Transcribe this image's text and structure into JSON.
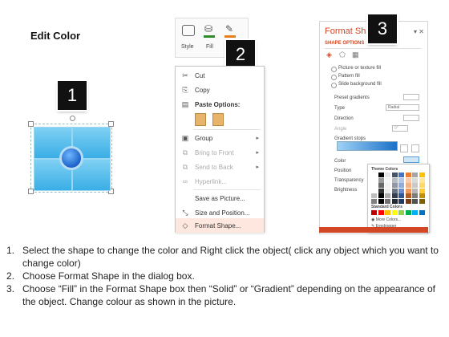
{
  "title": "Edit Color",
  "badges": {
    "one": "1",
    "two": "2",
    "three": "3"
  },
  "ribbon": {
    "style": "Style",
    "fill": "Fill",
    "outline": "O"
  },
  "context_menu": {
    "items": [
      {
        "icon": "scissors-icon",
        "glyph": "✂",
        "label": "Cut",
        "disabled": false
      },
      {
        "icon": "copy-icon",
        "glyph": "⎘",
        "label": "Copy",
        "disabled": false
      },
      {
        "icon": "clipboard-icon",
        "glyph": "📋",
        "label": "Paste Options:",
        "disabled": false
      },
      {
        "icon": "group-icon",
        "glyph": "▣",
        "label": "Group",
        "disabled": false,
        "submenu": true
      },
      {
        "icon": "bring-front-icon",
        "glyph": "⧉",
        "label": "Bring to Front",
        "disabled": true,
        "submenu": true
      },
      {
        "icon": "send-back-icon",
        "glyph": "⧉",
        "label": "Send to Back",
        "disabled": true,
        "submenu": true
      },
      {
        "icon": "hyperlink-icon",
        "glyph": "🔗",
        "label": "Hyperlink...",
        "disabled": true
      },
      {
        "icon": "",
        "glyph": "",
        "label": "Save as Picture...",
        "disabled": false
      },
      {
        "icon": "size-position-icon",
        "glyph": "⤡",
        "label": "Size and Position...",
        "disabled": false
      },
      {
        "icon": "format-shape-icon",
        "glyph": "◇",
        "label": "Format Shape...",
        "disabled": false,
        "highlighted": true
      }
    ]
  },
  "format_pane": {
    "title": "Format Shape",
    "tab": "SHAPE OPTIONS",
    "fill_options": [
      "Picture or texture fill",
      "Pattern fill",
      "Slide background fill"
    ],
    "rows": [
      {
        "label": "Preset gradients",
        "value": ""
      },
      {
        "label": "Type",
        "value": "Radial"
      },
      {
        "label": "Direction",
        "value": ""
      },
      {
        "label": "Angle",
        "value": "0°"
      },
      {
        "label": "Gradient stops",
        "value": ""
      },
      {
        "label": "Color",
        "value": ""
      },
      {
        "label": "Position",
        "value": ""
      },
      {
        "label": "Transparency",
        "value": ""
      },
      {
        "label": "Brightness",
        "value": ""
      }
    ],
    "theme_colors_label": "Theme Colors",
    "standard_colors_label": "Standard Colors",
    "more_colors": "More Colors...",
    "eyedropper": "Eyedropper"
  },
  "instructions": [
    {
      "num": "1.",
      "text": "Select the shape to change the color and Right click the object( click any object which you want to change color)"
    },
    {
      "num": "2.",
      "text": "Choose Format Shape in the dialog box."
    },
    {
      "num": "3.",
      "text": "Choose “Fill” in the Format Shape box then “Solid” or “Gradient” depending on the appearance of the object. Change colour as shown in the picture."
    }
  ],
  "colors": {
    "accent": "#d24726",
    "shape": "#3aaee6",
    "badge": "#111111"
  }
}
